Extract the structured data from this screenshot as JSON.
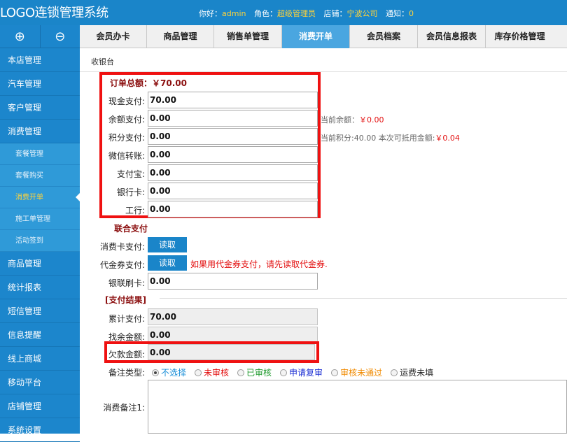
{
  "header": {
    "logo": "LOGO连锁管理系统",
    "hello_label": "你好：",
    "user": "admin",
    "role_label": "角色：",
    "role": "超级管理员",
    "store_label": "店铺：",
    "store": "宁波公司",
    "notice_label": "通知：",
    "notice_count": "0"
  },
  "sidebar": {
    "add_icon": "⊕",
    "remove_icon": "⊖",
    "items": [
      "本店管理",
      "汽车管理",
      "客户管理",
      "消费管理"
    ],
    "subitems": [
      "套餐管理",
      "套餐购买",
      "消费开单",
      "施工单管理",
      "活动签到"
    ],
    "items_after": [
      "商品管理",
      "统计报表",
      "短信管理",
      "信息提醒",
      "线上商城",
      "移动平台",
      "店铺管理",
      "系统设置"
    ]
  },
  "tabs": [
    "会员办卡",
    "商品管理",
    "销售单管理",
    "消费开单",
    "会员档案",
    "会员信息报表",
    "库存价格管理"
  ],
  "breadcrumb": "收银台",
  "order": {
    "total_label": "订单总额：",
    "total_value": "￥70.00"
  },
  "payments": [
    {
      "label": "现金支付:",
      "value": "70.00"
    },
    {
      "label": "余额支付:",
      "value": "0.00"
    },
    {
      "label": "积分支付:",
      "value": "0.00"
    },
    {
      "label": "微信转账:",
      "value": "0.00"
    },
    {
      "label": "支付宝:",
      "value": "0.00"
    },
    {
      "label": "银行卡:",
      "value": "0.00"
    },
    {
      "label": "工行:",
      "value": "0.00"
    }
  ],
  "hints": {
    "balance_label": "当前余额：",
    "balance_value": "￥0.00",
    "points_label": "当前积分:40.00 本次可抵用金额:",
    "points_value": "￥0.04"
  },
  "combined": {
    "title": "联合支付",
    "card_label": "消费卡支付:",
    "card_button": "读取",
    "voucher_label": "代金券支付:",
    "voucher_button": "读取",
    "voucher_warning": "如果用代金券支付，请先读取代金券.",
    "unionpay_label": "银联刷卡:",
    "unionpay_value": "0.00"
  },
  "result": {
    "title": "[支付结果]",
    "cumulative_label": "累计支付:",
    "cumulative_value": "70.00",
    "change_label": "找余金额:",
    "change_value": "0.00",
    "debt_label": "欠款金额:",
    "debt_value": "0.00"
  },
  "remark": {
    "type_label": "备注类型:",
    "options": [
      {
        "label": "不选择",
        "color": "#1a8fd8",
        "checked": true
      },
      {
        "label": "未审核",
        "color": "#e30f0f",
        "checked": false
      },
      {
        "label": "已审核",
        "color": "#1f9a2d",
        "checked": false
      },
      {
        "label": "申请复审",
        "color": "#1c2fd3",
        "checked": false
      },
      {
        "label": "审核未通过",
        "color": "#f08a00",
        "checked": false
      },
      {
        "label": "运费未填",
        "color": "#222222",
        "checked": false
      }
    ],
    "note_label": "消费备注1:"
  },
  "colors": {
    "brand": "#1a85c9",
    "highlight_box": "#ef1111",
    "warning": "#e30f0f"
  }
}
